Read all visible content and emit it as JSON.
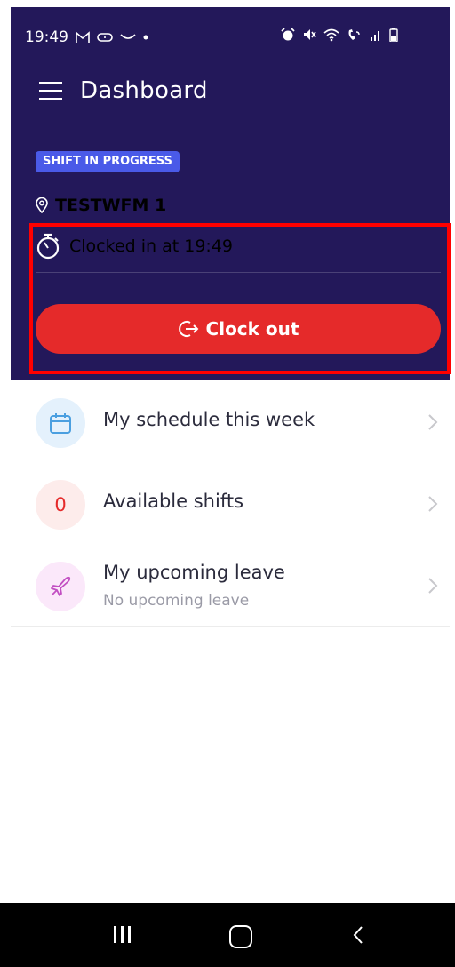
{
  "status_bar": {
    "time": "19:49",
    "left_icons": [
      "gmail-icon",
      "link-icon",
      "arc-icon",
      "dot-icon"
    ],
    "right_icons": [
      "alarm-icon",
      "mute-icon",
      "wifi-icon",
      "wifi-calling-icon",
      "signal-icon",
      "battery-icon"
    ]
  },
  "header": {
    "title": "Dashboard",
    "badge": "SHIFT IN PROGRESS",
    "location": "TESTWFM 1",
    "clocked_in_text": "Clocked in at 19:49",
    "clock_out_label": "Clock out"
  },
  "list": [
    {
      "title": "My schedule this week",
      "icon": "calendar-icon"
    },
    {
      "title": "Available shifts",
      "count": "0"
    },
    {
      "title": "My upcoming leave",
      "subtitle": "No upcoming leave",
      "icon": "plane-icon"
    }
  ],
  "colors": {
    "header_bg": "#23185a",
    "badge_bg": "#4a5ae8",
    "clock_out_bg": "#e52a2a",
    "highlight": "#ff0000"
  },
  "nav_bar": {
    "icons": [
      "recents-icon",
      "home-icon",
      "back-icon"
    ]
  }
}
